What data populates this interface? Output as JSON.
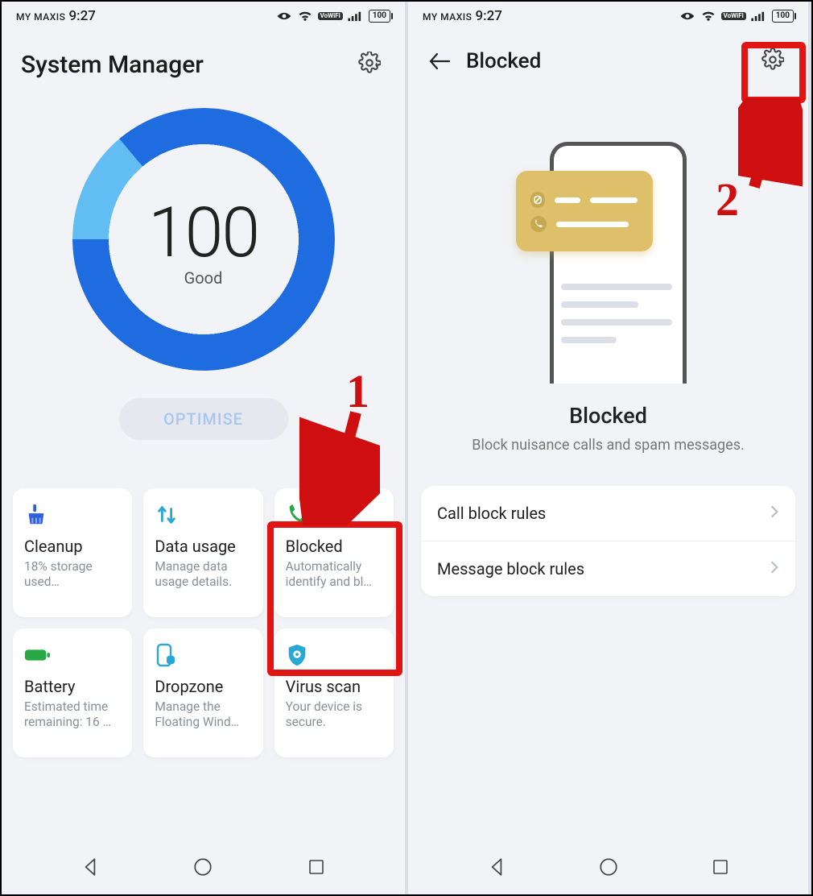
{
  "status": {
    "carrier": "MY MAXIS",
    "clock": "9:27",
    "vowifi": "VoWiFi",
    "battery": "100"
  },
  "left": {
    "title": "System Manager",
    "score": "100",
    "score_label": "Good",
    "optimise": "OPTIMISE",
    "tiles": [
      {
        "name": "Cleanup",
        "desc": "18% storage used…",
        "icon": "broom"
      },
      {
        "name": "Data usage",
        "desc": "Manage data usage details.",
        "icon": "arrows"
      },
      {
        "name": "Blocked",
        "desc": "Automatically identify and bl…",
        "icon": "phone-block"
      },
      {
        "name": "Battery",
        "desc": "Estimated time remaining: 16 …",
        "icon": "battery"
      },
      {
        "name": "Dropzone",
        "desc": "Manage the Floating Wind…",
        "icon": "dropzone"
      },
      {
        "name": "Virus scan",
        "desc": "Your device is secure.",
        "icon": "shield"
      }
    ]
  },
  "right": {
    "title": "Blocked",
    "hero_title": "Blocked",
    "hero_sub": "Block nuisance calls and spam messages.",
    "rules": [
      {
        "label": "Call block rules"
      },
      {
        "label": "Message block rules"
      }
    ]
  },
  "annotations": {
    "step1": "1",
    "step2": "2"
  }
}
